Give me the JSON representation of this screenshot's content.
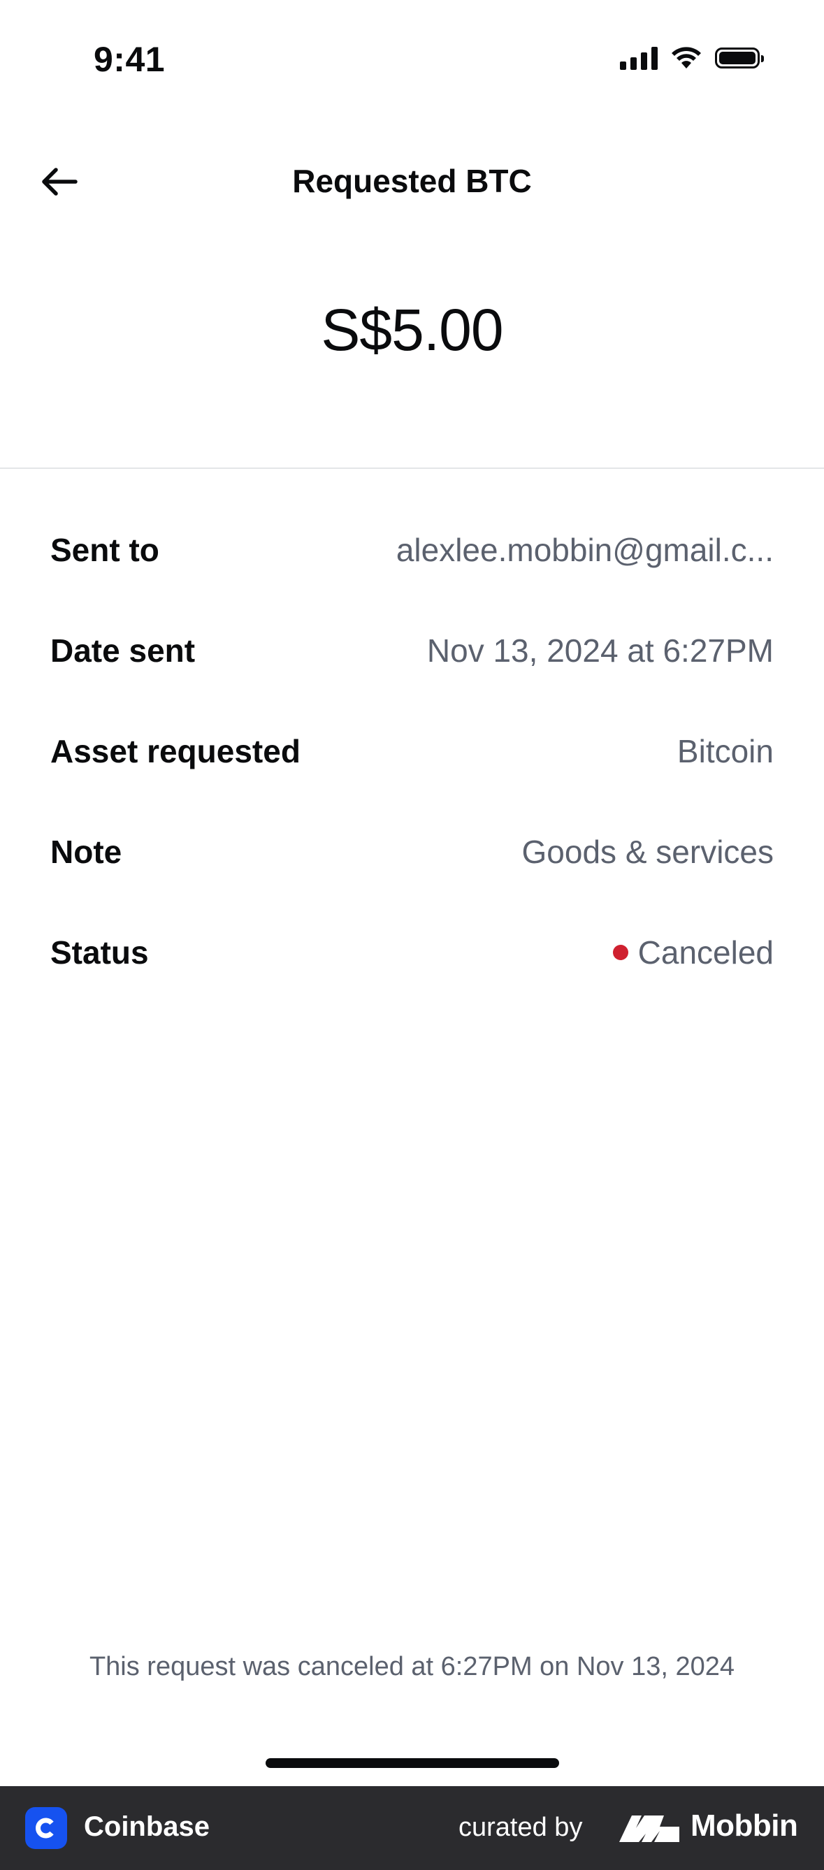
{
  "status_bar": {
    "time": "9:41"
  },
  "header": {
    "title": "Requested BTC",
    "back_icon": "arrow-left-icon"
  },
  "amount": "S$5.00",
  "details": [
    {
      "label": "Sent to",
      "value": "alexlee.mobbin@gmail.c..."
    },
    {
      "label": "Date sent",
      "value": "Nov 13, 2024 at 6:27PM"
    },
    {
      "label": "Asset requested",
      "value": "Bitcoin"
    },
    {
      "label": "Note",
      "value": "Goods & services"
    },
    {
      "label": "Status",
      "value": "Canceled"
    }
  ],
  "status_color": "#cf202f",
  "footer_note": "This request was canceled at 6:27PM on Nov 13, 2024",
  "branding": {
    "app_name": "Coinbase",
    "curated_by": "curated by",
    "mobbin": "Mobbin",
    "coinbase_color": "#1652f0"
  }
}
